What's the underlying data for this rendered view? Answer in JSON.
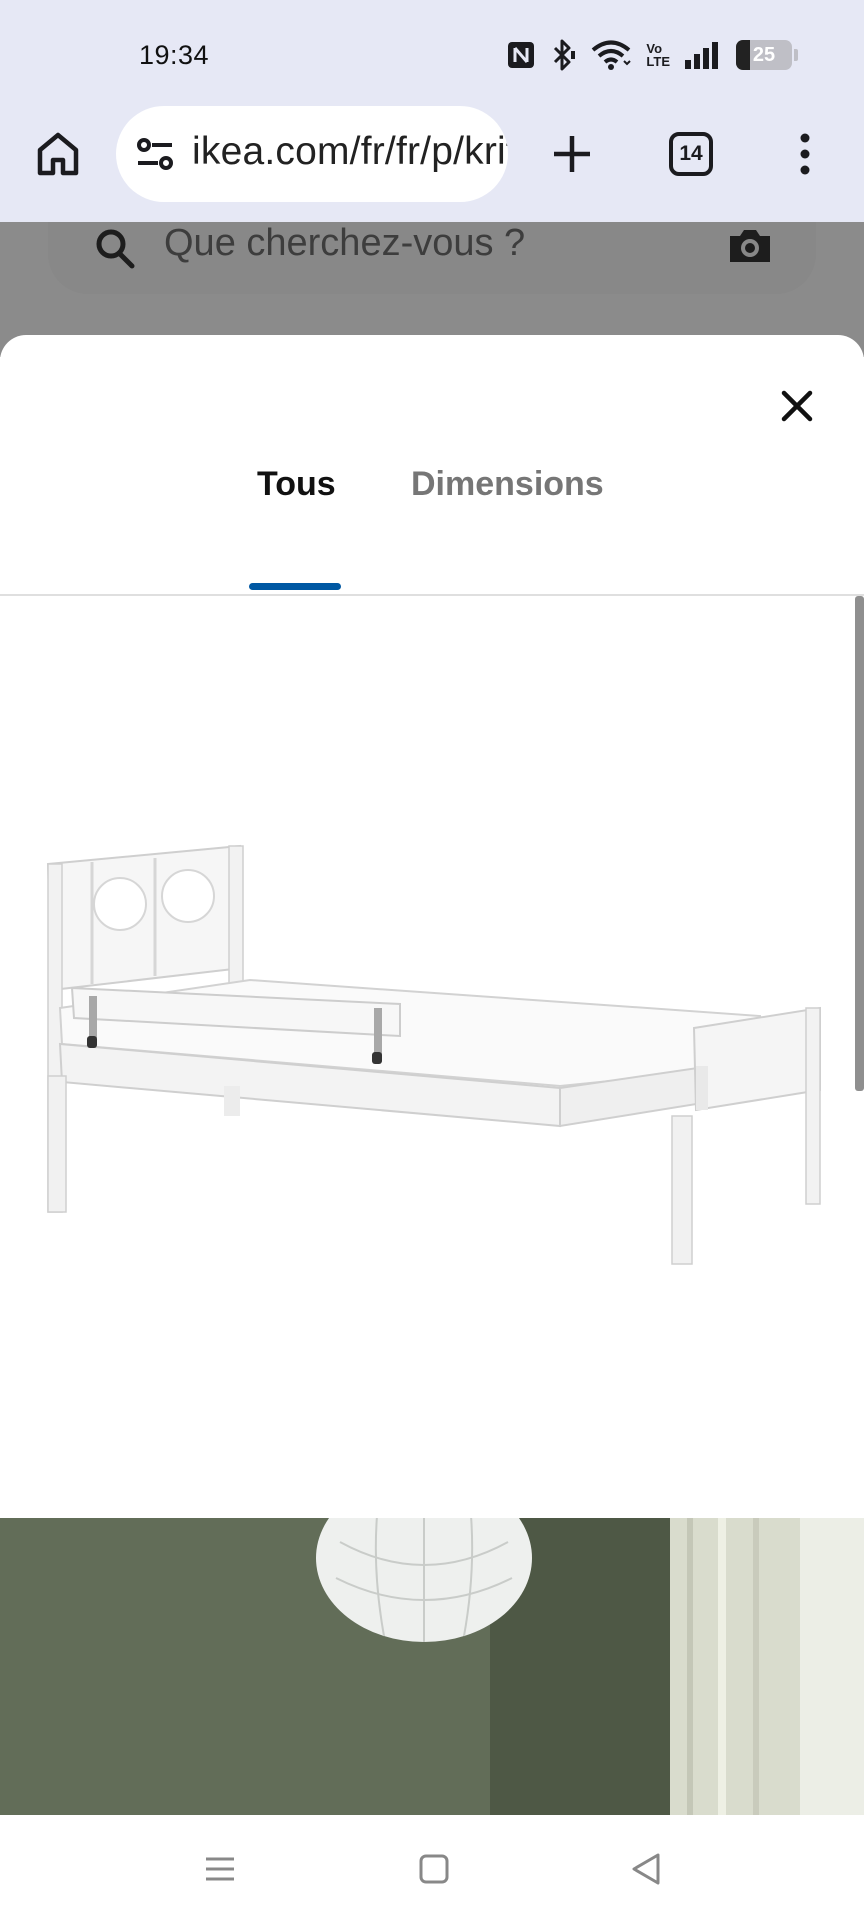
{
  "status_bar": {
    "time": "19:34",
    "battery_level": "25",
    "battery_fraction": 0.25,
    "icons": [
      "nfc-icon",
      "bluetooth-icon",
      "wifi-icon",
      "volte-icon",
      "signal-icon",
      "battery-icon"
    ],
    "volte_label_top": "Vo",
    "volte_label_bottom": "LTE"
  },
  "browser": {
    "url": "ikea.com/fr/fr/p/kritter",
    "tab_count": "14",
    "icons": [
      "home-icon",
      "site-settings-icon",
      "plus-icon",
      "more-vert-icon"
    ]
  },
  "page": {
    "search_placeholder": "Que cherchez-vous ?",
    "search_icons": [
      "search-icon",
      "camera-icon"
    ]
  },
  "modal": {
    "tabs": [
      {
        "label": "Tous",
        "active": true
      },
      {
        "label": "Dimensions",
        "active": false
      }
    ],
    "accent_color": "#0058a3",
    "images": [
      {
        "alt": "product-bed-image"
      },
      {
        "alt": "room-scene-image"
      }
    ]
  },
  "nav": {
    "icons": [
      "recents-icon",
      "home-square-icon",
      "back-icon"
    ]
  }
}
